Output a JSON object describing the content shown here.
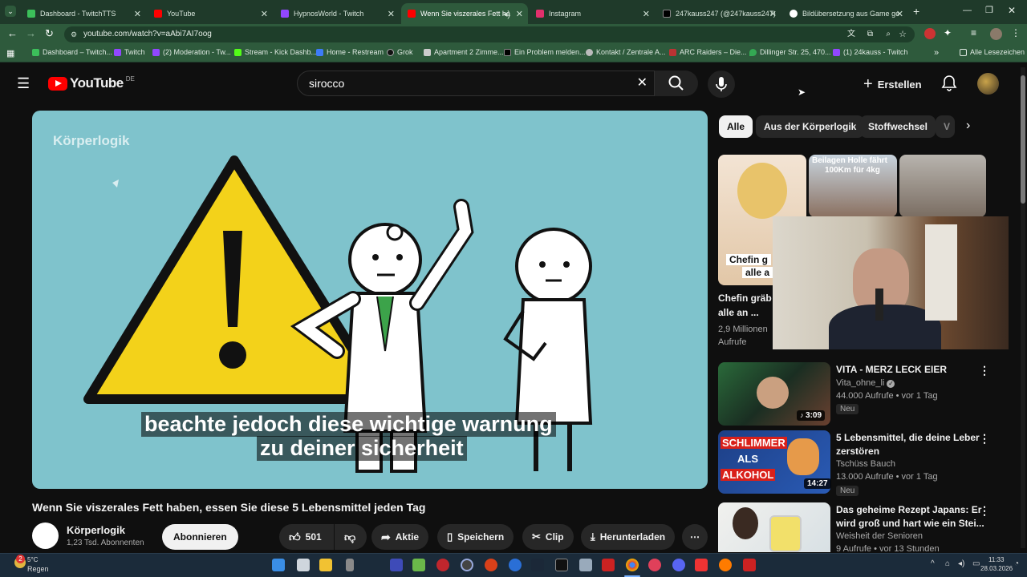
{
  "tabs": [
    {
      "label": "Dashboard - TwitchTTS",
      "color": "#ffffff",
      "active": false
    },
    {
      "label": "YouTube",
      "color": "#ff0000",
      "active": false
    },
    {
      "label": "HypnosWorld - Twitch",
      "color": "#9147ff",
      "active": false
    },
    {
      "label": "Wenn Sie viszerales Fett ha",
      "color": "#ff0000",
      "active": true
    },
    {
      "label": "Instagram",
      "color": "#e1306c",
      "active": false
    },
    {
      "label": "247kauss247 (@247kauss247)",
      "color": "#000000",
      "active": false
    },
    {
      "label": "Bildübersetzung aus Game ge",
      "color": "#ffffff",
      "active": false
    }
  ],
  "address": {
    "url": "youtube.com/watch?v=aAbi7AI7oog"
  },
  "bookmarks": [
    {
      "label": "Dashboard – Twitch..."
    },
    {
      "label": "Twitch"
    },
    {
      "label": "(2) Moderation - Tw..."
    },
    {
      "label": "Stream - Kick Dashb..."
    },
    {
      "label": "Home - Restream"
    },
    {
      "label": "Grok"
    },
    {
      "label": "Apartment 2 Zimme..."
    },
    {
      "label": "Ein Problem melden..."
    },
    {
      "label": "Kontakt / Zentrale A..."
    },
    {
      "label": "ARC Raiders – Die..."
    },
    {
      "label": "Dillinger Str. 25, 470..."
    },
    {
      "label": "(1) 24kauss - Twitch"
    }
  ],
  "bookmarks_more": "»",
  "all_bookmarks": "Alle Lesezeichen",
  "youtube": {
    "logo": "YouTube",
    "region": "DE",
    "search_value": "sirocco",
    "create_label": "Erstellen"
  },
  "video": {
    "watermark": "Körperlogik",
    "subtitle_line1": "beachte jedoch diese wichtige warnung",
    "subtitle_line2": "zu deiner sicherheit",
    "title": "Wenn Sie viszerales Fett haben, essen Sie diese 5 Lebensmittel jeden Tag"
  },
  "channel": {
    "name": "Körperlogik",
    "subscribers": "1,23 Tsd. Abonnenten",
    "subscribe": "Abonnieren"
  },
  "actions": {
    "likes": "501",
    "share": "Aktie",
    "save": "Speichern",
    "clip": "Clip",
    "download": "Herunterladen"
  },
  "chips": [
    "Alle",
    "Aus der Körperlogik",
    "Stoffwechsel",
    "V"
  ],
  "top_recs": {
    "thumb2_caption_1": "Beilagen Holle fährt",
    "thumb2_caption_2": "100Km für 4kg",
    "thumb1_caption_1": "Chefin g",
    "thumb1_caption_2": "alle a",
    "title_1": "Chefin gräb",
    "title_2": "alle an ...",
    "views_1": "2,9 Millionen",
    "views_2": "Aufrufe"
  },
  "recs": [
    {
      "title_1": "VITA - MERZ LECK EIER",
      "title_2": "",
      "channel": "Vita_ohne_li",
      "views": "44.000 Aufrufe • vor 1 Tag",
      "badge": "Neu",
      "duration": "3:09"
    },
    {
      "title_1": "5 Lebensmittel, die deine Leber",
      "title_2": "zerstören",
      "channel": "Tschüss Bauch",
      "views": "13.000 Aufrufe • vor 1 Tag",
      "badge": "Neu",
      "duration": "14:27",
      "thumb_text_1": "SCHLIMMER",
      "thumb_text_2": "ALS",
      "thumb_text_3": "ALKOHOL"
    },
    {
      "title_1": "Das geheime Rezept Japans: Er",
      "title_2": "wird groß und hart wie ein Stei...",
      "channel": "Weisheit der Senioren",
      "views": "9 Aufrufe • vor 13 Stunden"
    }
  ],
  "taskbar": {
    "weather_temp": "5°C",
    "weather_desc": "Regen",
    "notif_count": "2",
    "time": "11:33",
    "date": "28.03.2026"
  }
}
